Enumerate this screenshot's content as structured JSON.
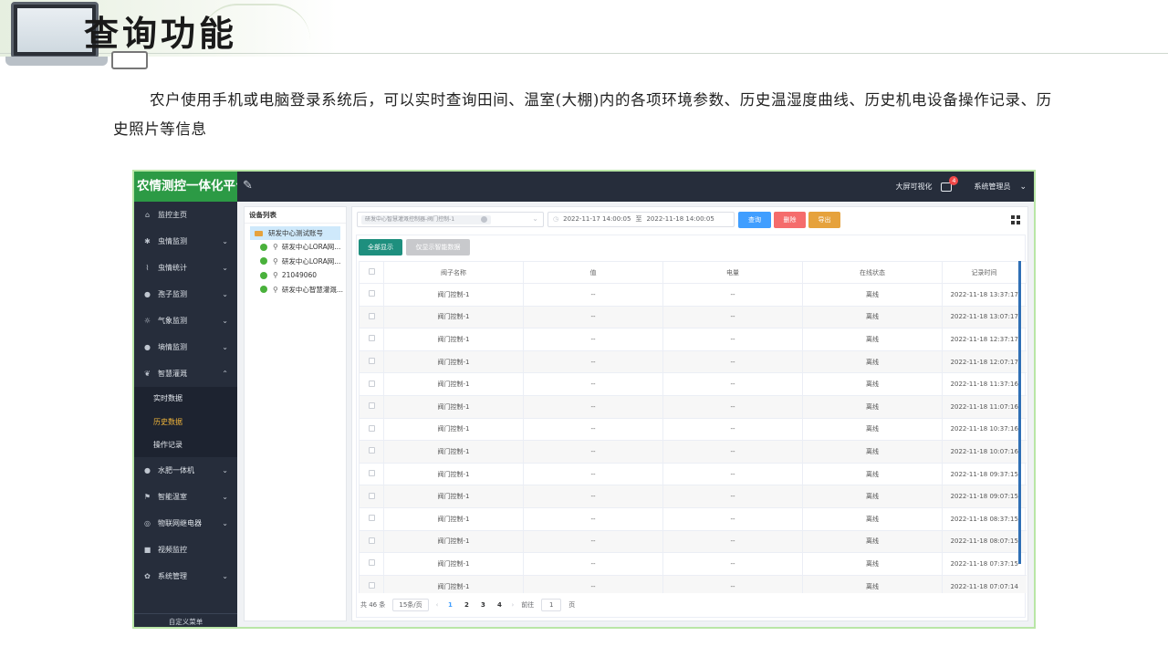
{
  "slide": {
    "title": "查询功能",
    "intro": "农户使用手机或电脑登录系统后，可以实时查询田间、温室(大棚)内的各项环境参数、历史温湿度曲线、历史机电设备操作记录、历史照片等信息"
  },
  "app": {
    "brand": "农情测控一体化平台",
    "edit_icon": "edit-icon",
    "topbar": {
      "bigscreen_label": "大屏可视化",
      "message_badge": "4",
      "user_label": "系统管理员"
    },
    "colors": {
      "brand_green": "#2c9a45",
      "dark_nav": "#262d3b",
      "active_sub": "#f0b43a",
      "query": "#409eff",
      "delete": "#f56c6c",
      "export": "#e6a23c",
      "show_all": "#1e8f7e"
    },
    "sidebar": {
      "items": [
        {
          "label": "监控主页",
          "icon": "home-icon",
          "caret": ""
        },
        {
          "label": "虫情监测",
          "icon": "bug-icon",
          "caret": "⌄"
        },
        {
          "label": "虫情统计",
          "icon": "chart-icon",
          "caret": "⌄"
        },
        {
          "label": "孢子监测",
          "icon": "spore-icon",
          "caret": "⌄"
        },
        {
          "label": "气象监测",
          "icon": "weather-icon",
          "caret": "⌄"
        },
        {
          "label": "墒情监测",
          "icon": "soil-icon",
          "caret": "⌄"
        },
        {
          "label": "智慧灌溉",
          "icon": "leaf-icon",
          "caret": "⌃"
        }
      ],
      "sub_items": [
        {
          "label": "实时数据"
        },
        {
          "label": "历史数据"
        },
        {
          "label": "操作记录"
        }
      ],
      "items_after": [
        {
          "label": "水肥一体机",
          "icon": "drop-icon",
          "caret": "⌄"
        },
        {
          "label": "智能温室",
          "icon": "flag-icon",
          "caret": "⌄"
        },
        {
          "label": "物联网继电器",
          "icon": "relay-icon",
          "caret": "⌄"
        },
        {
          "label": "视频监控",
          "icon": "camera-icon",
          "caret": ""
        },
        {
          "label": "系统管理",
          "icon": "gear-icon",
          "caret": "⌄"
        }
      ],
      "footer": "自定义菜单"
    },
    "device_tree": {
      "title": "设备列表",
      "root": "研发中心测试账号",
      "nodes": [
        "研发中心LORA网...",
        "研发中心LORA网...",
        "21049060",
        "研发中心智慧灌溉..."
      ]
    },
    "filters": {
      "selected_device": "研发中心智慧灌溉控制器-阀门控制-1",
      "date_start": "2022-11-17 14:00:05",
      "date_sep": "至",
      "date_end": "2022-11-18 14:00:05",
      "query_label": "查询",
      "delete_label": "删除",
      "export_label": "导出"
    },
    "table": {
      "show_all_label": "全部显示",
      "fav_label": "仅显示智能数据",
      "columns": [
        "",
        "阀子名称",
        "值",
        "电量",
        "在线状态",
        "记录时间"
      ],
      "rows": [
        [
          "阀门控制-1",
          "--",
          "--",
          "离线",
          "2022-11-18 13:37:17"
        ],
        [
          "阀门控制-1",
          "--",
          "--",
          "离线",
          "2022-11-18 13:07:17"
        ],
        [
          "阀门控制-1",
          "--",
          "--",
          "离线",
          "2022-11-18 12:37:17"
        ],
        [
          "阀门控制-1",
          "--",
          "--",
          "离线",
          "2022-11-18 12:07:17"
        ],
        [
          "阀门控制-1",
          "--",
          "--",
          "离线",
          "2022-11-18 11:37:16"
        ],
        [
          "阀门控制-1",
          "--",
          "--",
          "离线",
          "2022-11-18 11:07:16"
        ],
        [
          "阀门控制-1",
          "--",
          "--",
          "离线",
          "2022-11-18 10:37:16"
        ],
        [
          "阀门控制-1",
          "--",
          "--",
          "离线",
          "2022-11-18 10:07:16"
        ],
        [
          "阀门控制-1",
          "--",
          "--",
          "离线",
          "2022-11-18 09:37:15"
        ],
        [
          "阀门控制-1",
          "--",
          "--",
          "离线",
          "2022-11-18 09:07:15"
        ],
        [
          "阀门控制-1",
          "--",
          "--",
          "离线",
          "2022-11-18 08:37:15"
        ],
        [
          "阀门控制-1",
          "--",
          "--",
          "离线",
          "2022-11-18 08:07:15"
        ],
        [
          "阀门控制-1",
          "--",
          "--",
          "离线",
          "2022-11-18 07:37:15"
        ],
        [
          "阀门控制-1",
          "--",
          "--",
          "离线",
          "2022-11-18 07:07:14"
        ]
      ]
    },
    "pager": {
      "total": "共 46 条",
      "page_size": "15条/页",
      "pages": [
        "1",
        "2",
        "3",
        "4"
      ],
      "current_page": "1",
      "goto_label": "前往",
      "goto_value": "1",
      "page_unit": "页"
    }
  }
}
